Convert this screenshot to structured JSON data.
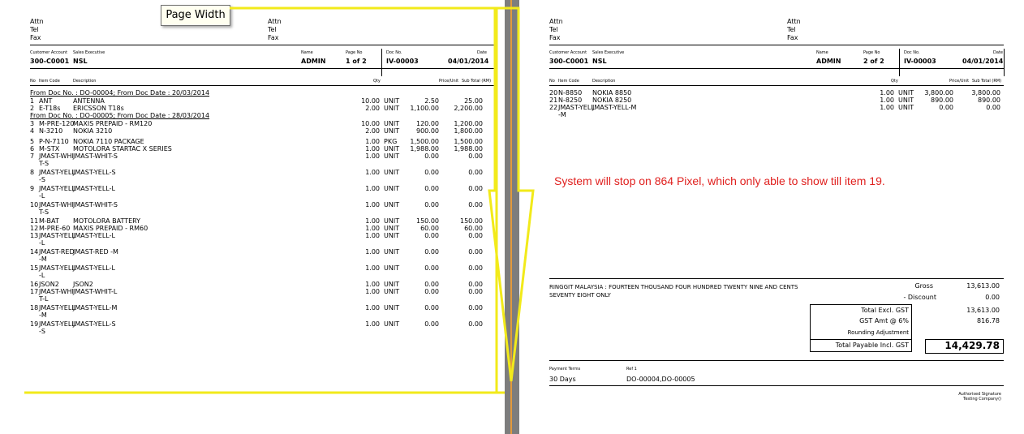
{
  "tooltip": "Page Width",
  "note": "System will stop on 864 Pixel, which only able to show till item 19.",
  "colors": {
    "highlight": "#f2ea1a",
    "note": "#e0201e",
    "divider": "#7d7d7d"
  },
  "header": {
    "attn": "Attn",
    "tel": "Tel",
    "fax": "Fax",
    "customer_account_label": "Customer Account",
    "sales_executive_label": "Sales Executive",
    "name_label": "Name",
    "page_no_label": "Page No",
    "doc_no_label": "Doc No.",
    "date_label": "Date",
    "customer_account": "300-C0001",
    "sales_executive": "NSL",
    "name": "ADMIN",
    "doc_no": "IV-00003",
    "date": "04/01/2014"
  },
  "columns": {
    "no": "No",
    "item_code": "Item Code",
    "description": "Description",
    "qty": "Qty",
    "price": "Price/Unit",
    "subtotal": "Sub Total (RM)"
  },
  "page1": {
    "page_no": "1 of 2",
    "lines": [
      {
        "type": "ref",
        "text": "From Doc No. : DO-00004;   From Doc Date : 20/03/2014"
      },
      {
        "type": "item",
        "no": "1",
        "code": "ANT",
        "desc": "ANTENNA",
        "qty": "10.00",
        "uom": "UNIT",
        "price": "2.50",
        "sub": "25.00"
      },
      {
        "type": "item",
        "no": "2",
        "code": "E-T18s",
        "desc": "ERICSSON T18s",
        "qty": "2.00",
        "uom": "UNIT",
        "price": "1,100.00",
        "sub": "2,200.00"
      },
      {
        "type": "ref",
        "text": "From Doc No. : DO-00005;   From Doc Date : 28/03/2014"
      },
      {
        "type": "item",
        "no": "3",
        "code": "M-PRE-120",
        "desc": "MAXIS PREPAID - RM120",
        "qty": "10.00",
        "uom": "UNIT",
        "price": "120.00",
        "sub": "1,200.00"
      },
      {
        "type": "item",
        "no": "4",
        "code": "N-3210",
        "desc": "NOKIA 3210",
        "qty": "2.00",
        "uom": "UNIT",
        "price": "900.00",
        "sub": "1,800.00"
      },
      {
        "type": "item",
        "no": "5",
        "code": "P-N-7110",
        "desc": "NOKIA 7110 PACKAGE",
        "qty": "1.00",
        "uom": "PKG",
        "price": "1,500.00",
        "sub": "1,500.00"
      },
      {
        "type": "item",
        "no": "6",
        "code": "M-STX",
        "desc": "MOTOLORA STARTAC X SERIES",
        "qty": "1.00",
        "uom": "UNIT",
        "price": "1,988.00",
        "sub": "1,988.00"
      },
      {
        "type": "item",
        "no": "7",
        "code": "JMAST-WHI",
        "code2": "T-S",
        "desc": "JMAST-WHIT-S",
        "qty": "1.00",
        "uom": "UNIT",
        "price": "0.00",
        "sub": "0.00"
      },
      {
        "type": "item",
        "no": "8",
        "code": "JMAST-YELL",
        "code2": "-S",
        "desc": "JMAST-YELL-S",
        "qty": "1.00",
        "uom": "UNIT",
        "price": "0.00",
        "sub": "0.00"
      },
      {
        "type": "item",
        "no": "9",
        "code": "JMAST-YELL",
        "code2": "-L",
        "desc": "JMAST-YELL-L",
        "qty": "1.00",
        "uom": "UNIT",
        "price": "0.00",
        "sub": "0.00"
      },
      {
        "type": "item",
        "no": "10",
        "code": "JMAST-WHI",
        "code2": "T-S",
        "desc": "JMAST-WHIT-S",
        "qty": "1.00",
        "uom": "UNIT",
        "price": "0.00",
        "sub": "0.00"
      },
      {
        "type": "item",
        "no": "11",
        "code": "M-BAT",
        "desc": "MOTOLORA BATTERY",
        "qty": "1.00",
        "uom": "UNIT",
        "price": "150.00",
        "sub": "150.00"
      },
      {
        "type": "item",
        "no": "12",
        "code": "M-PRE-60",
        "desc": "MAXIS PREPAID - RM60",
        "qty": "1.00",
        "uom": "UNIT",
        "price": "60.00",
        "sub": "60.00"
      },
      {
        "type": "item",
        "no": "13",
        "code": "JMAST-YELL",
        "code2": "-L",
        "desc": "JMAST-YELL-L",
        "qty": "1.00",
        "uom": "UNIT",
        "price": "0.00",
        "sub": "0.00"
      },
      {
        "type": "item",
        "no": "14",
        "code": "JMAST-RED",
        "code2": "-M",
        "desc": "JMAST-RED -M",
        "qty": "1.00",
        "uom": "UNIT",
        "price": "0.00",
        "sub": "0.00"
      },
      {
        "type": "item",
        "no": "15",
        "code": "JMAST-YELL",
        "code2": "-L",
        "desc": "JMAST-YELL-L",
        "qty": "1.00",
        "uom": "UNIT",
        "price": "0.00",
        "sub": "0.00"
      },
      {
        "type": "item",
        "no": "16",
        "code": "JSON2",
        "desc": "JSON2",
        "qty": "1.00",
        "uom": "UNIT",
        "price": "0.00",
        "sub": "0.00"
      },
      {
        "type": "item",
        "no": "17",
        "code": "JMAST-WHI",
        "code2": "T-L",
        "desc": "JMAST-WHIT-L",
        "qty": "1.00",
        "uom": "UNIT",
        "price": "0.00",
        "sub": "0.00"
      },
      {
        "type": "item",
        "no": "18",
        "code": "JMAST-YELL",
        "code2": "-M",
        "desc": "JMAST-YELL-M",
        "qty": "1.00",
        "uom": "UNIT",
        "price": "0.00",
        "sub": "0.00"
      },
      {
        "type": "item",
        "no": "19",
        "code": "JMAST-YELL",
        "code2": "-S",
        "desc": "JMAST-YELL-S",
        "qty": "1.00",
        "uom": "UNIT",
        "price": "0.00",
        "sub": "0.00"
      }
    ]
  },
  "page2": {
    "page_no": "2 of 2",
    "lines": [
      {
        "type": "item",
        "no": "20",
        "code": "N-8850",
        "desc": "NOKIA 8850",
        "qty": "1.00",
        "uom": "UNIT",
        "price": "3,800.00",
        "sub": "3,800.00"
      },
      {
        "type": "item",
        "no": "21",
        "code": "N-8250",
        "desc": "NOKIA 8250",
        "qty": "1.00",
        "uom": "UNIT",
        "price": "890.00",
        "sub": "890.00"
      },
      {
        "type": "item",
        "no": "22",
        "code": "JMAST-YELL",
        "code2": "-M",
        "desc": "JMAST-YELL-M",
        "qty": "1.00",
        "uom": "UNIT",
        "price": "0.00",
        "sub": "0.00"
      }
    ],
    "amount_words_1": "RINGGIT MALAYSIA : FOURTEEN THOUSAND FOUR HUNDRED TWENTY NINE AND CENTS",
    "amount_words_2": "SEVENTY EIGHT ONLY",
    "gross_label": "Gross",
    "gross": "13,613.00",
    "discount_label": "- Discount",
    "discount": "0.00",
    "excl_label": "Total Excl. GST",
    "excl": "13,613.00",
    "gst_label": "GST Amt @ 6%",
    "gst": "816.78",
    "rounding_label": "Rounding Adjustment",
    "payable_label": "Total Payable Incl. GST",
    "payable": "14,429.78",
    "payment_terms_label": "Payment Terms",
    "payment_terms": "30 Days",
    "ref_label": "Ref 1",
    "ref": "DO-00004,DO-00005",
    "signature_label": "Authorised Signature",
    "company": "Testing Company()"
  }
}
